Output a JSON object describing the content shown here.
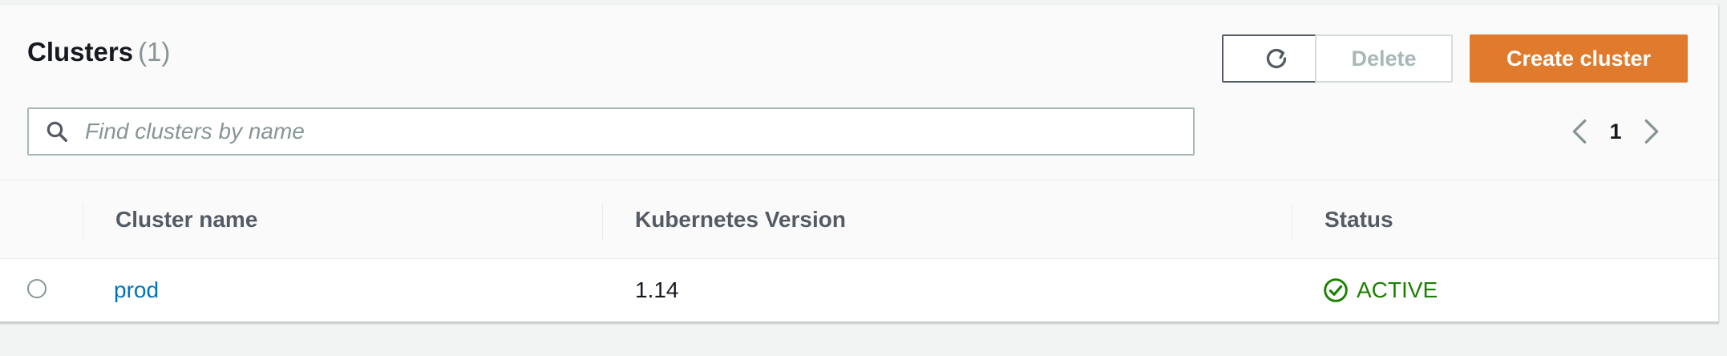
{
  "header": {
    "title": "Clusters",
    "count": "(1)"
  },
  "toolbar": {
    "refresh_icon": "refresh-icon",
    "delete_label": "Delete",
    "create_label": "Create cluster"
  },
  "search": {
    "placeholder": "Find clusters by name",
    "value": "",
    "icon": "search-icon"
  },
  "pagination": {
    "current_page": "1",
    "prev_icon": "chevron-left-icon",
    "next_icon": "chevron-right-icon"
  },
  "table": {
    "columns": [
      "Cluster name",
      "Kubernetes Version",
      "Status"
    ],
    "rows": [
      {
        "name": "prod",
        "version": "1.14",
        "status": "ACTIVE",
        "status_icon": "check-circle-icon"
      }
    ]
  },
  "colors": {
    "primary_button": "#e07b2d",
    "link": "#0073bb",
    "status_active": "#1d8102"
  }
}
